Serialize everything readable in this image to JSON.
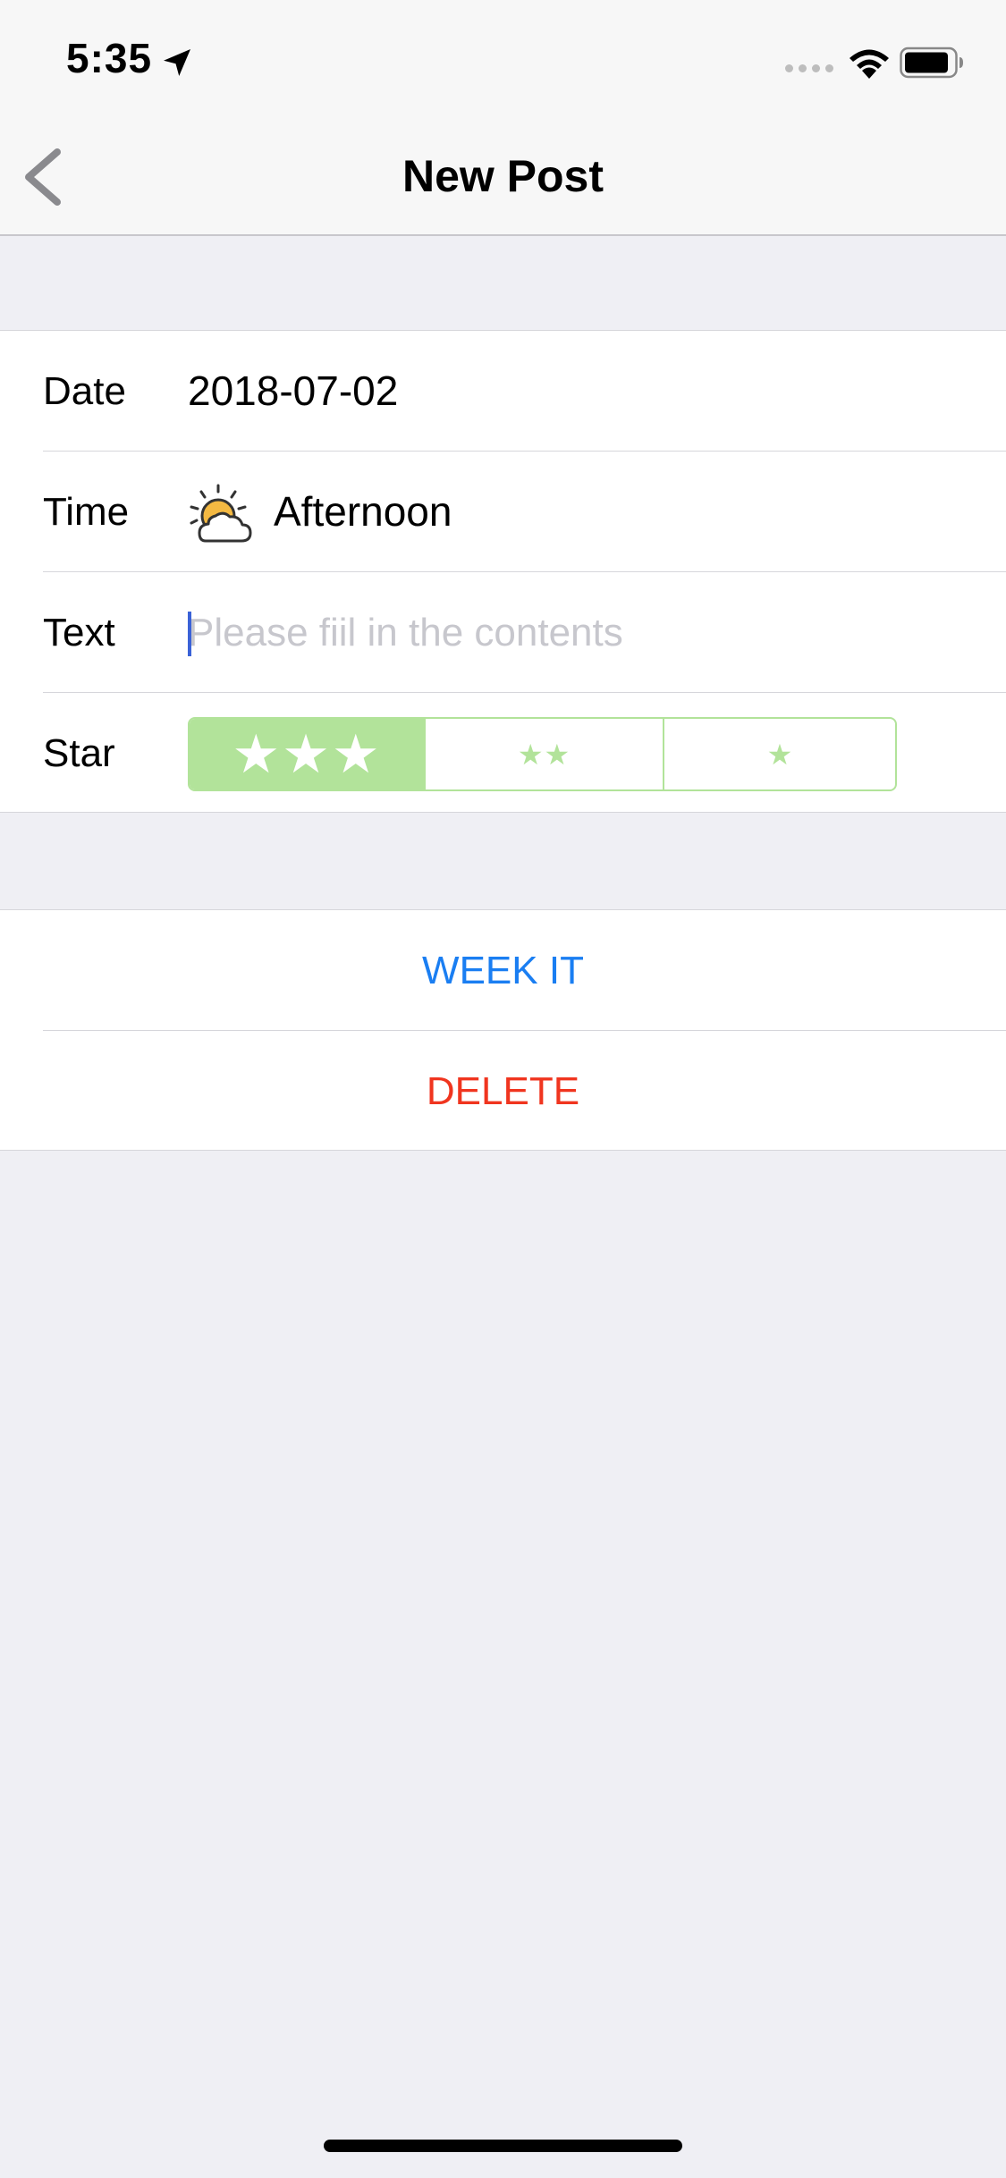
{
  "status_bar": {
    "time": "5:35",
    "icons": [
      "location-arrow-icon",
      "cellular-signal-icon",
      "wifi-icon",
      "battery-icon"
    ]
  },
  "nav": {
    "title": "New Post",
    "back_icon": "chevron-left-icon"
  },
  "form": {
    "date": {
      "label": "Date",
      "value": "2018-07-02"
    },
    "time": {
      "label": "Time",
      "value": "Afternoon",
      "icon": "partly-cloudy-sun-icon"
    },
    "text": {
      "label": "Text",
      "value": "",
      "placeholder": "Please fiil in the contents"
    },
    "star": {
      "label": "Star",
      "options": [
        "★★★",
        "★★",
        "★"
      ],
      "selected_index": 0,
      "selected_color": "#b2e39a"
    }
  },
  "actions": {
    "week_it": {
      "label": "WEEK IT",
      "color": "#1a7ef2"
    },
    "delete": {
      "label": "DELETE",
      "color": "#f0351f"
    }
  }
}
